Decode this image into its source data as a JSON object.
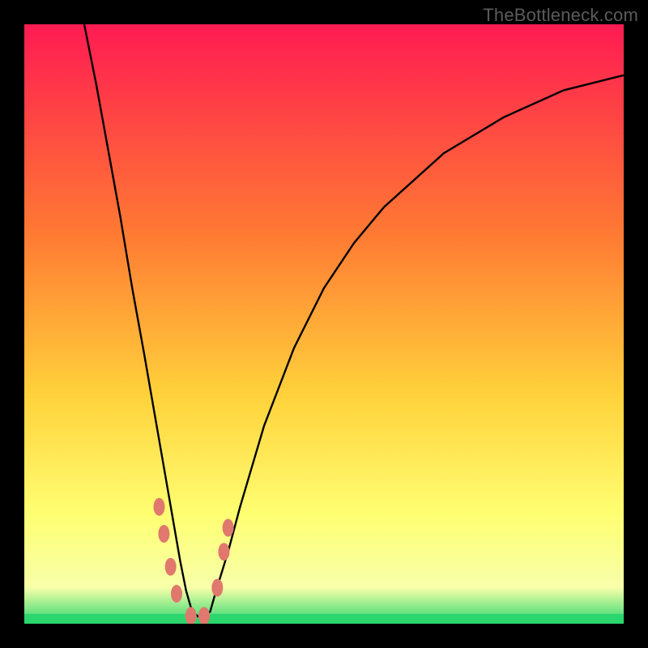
{
  "watermark": "TheBottleneck.com",
  "colors": {
    "background": "#000000",
    "watermark_text": "#5b5b5b",
    "curve_stroke": "#000000",
    "marker_fill": "#e0786d",
    "band_green": "#2bd66f",
    "gradient_top": "#ff1b52",
    "gradient_mid_a": "#ff7a33",
    "gradient_mid_b": "#ffd23b",
    "gradient_yellow": "#ffff73",
    "gradient_pale": "#f7ffa9",
    "gradient_bottom": "#2bd66f"
  },
  "chart_data": {
    "type": "line",
    "title": "",
    "xlabel": "",
    "ylabel": "",
    "xlim": [
      0,
      100
    ],
    "ylim": [
      0,
      100
    ],
    "notes": "Absolute-value style bottleneck curve with minimum near x≈28. Values estimated from pixel positions; no axes or tick labels are rendered in the source image.",
    "series": [
      {
        "name": "bottleneck-curve",
        "x": [
          10,
          12,
          14,
          16,
          18,
          20,
          22,
          24,
          26,
          27,
          28,
          29,
          30,
          31,
          32,
          34,
          36,
          40,
          45,
          50,
          55,
          60,
          70,
          80,
          90,
          100
        ],
        "y": [
          100,
          90,
          79,
          68,
          56,
          45,
          33.5,
          22,
          10.5,
          5.5,
          2,
          1.2,
          1.2,
          2,
          5.5,
          12,
          19.5,
          33,
          46,
          56,
          63.5,
          69.5,
          78.5,
          84.5,
          89,
          91.5
        ]
      }
    ],
    "markers": [
      {
        "x": 22.5,
        "y": 19.5
      },
      {
        "x": 23.3,
        "y": 15
      },
      {
        "x": 24.4,
        "y": 9.5
      },
      {
        "x": 25.4,
        "y": 5
      },
      {
        "x": 27.8,
        "y": 1.3
      },
      {
        "x": 30.0,
        "y": 1.3
      },
      {
        "x": 32.2,
        "y": 6
      },
      {
        "x": 33.3,
        "y": 12
      },
      {
        "x": 34.0,
        "y": 16
      }
    ]
  }
}
